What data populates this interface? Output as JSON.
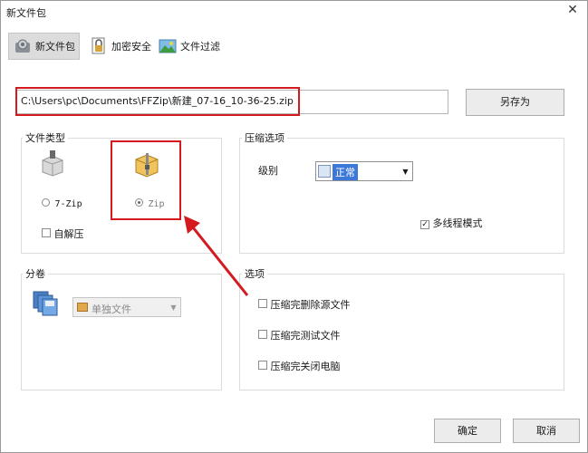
{
  "window": {
    "title": "新文件包",
    "close_glyph": "✕"
  },
  "tabs": [
    {
      "label": "新文件包",
      "icon": "new-package-icon",
      "active": true
    },
    {
      "label": "加密安全",
      "icon": "encrypt-icon",
      "active": false
    },
    {
      "label": "文件过滤",
      "icon": "filter-icon",
      "active": false
    }
  ],
  "output": {
    "path": "C:\\Users\\pc\\Documents\\FFZip\\新建_07-16_10-36-25.zip",
    "save_as_label": "另存为"
  },
  "file_type": {
    "title": "文件类型",
    "options": [
      {
        "label": "7-Zip",
        "selected": false
      },
      {
        "label": "Zip",
        "selected": true
      }
    ],
    "self_extract_label": "自解压"
  },
  "compression": {
    "title": "压缩选项",
    "level_label": "级别",
    "level_value": "正常",
    "multithread_label": "多线程模式",
    "multithread_checked": true
  },
  "split": {
    "title": "分卷",
    "value": "单独文件"
  },
  "options": {
    "title": "选项",
    "items": [
      {
        "label": "压缩完删除源文件",
        "checked": false
      },
      {
        "label": "压缩完测试文件",
        "checked": false
      },
      {
        "label": "压缩完关闭电脑",
        "checked": false
      }
    ]
  },
  "buttons": {
    "ok": "确定",
    "cancel": "取消"
  },
  "colors": {
    "highlight": "#d4191f",
    "select_blue": "#3c78d8"
  }
}
